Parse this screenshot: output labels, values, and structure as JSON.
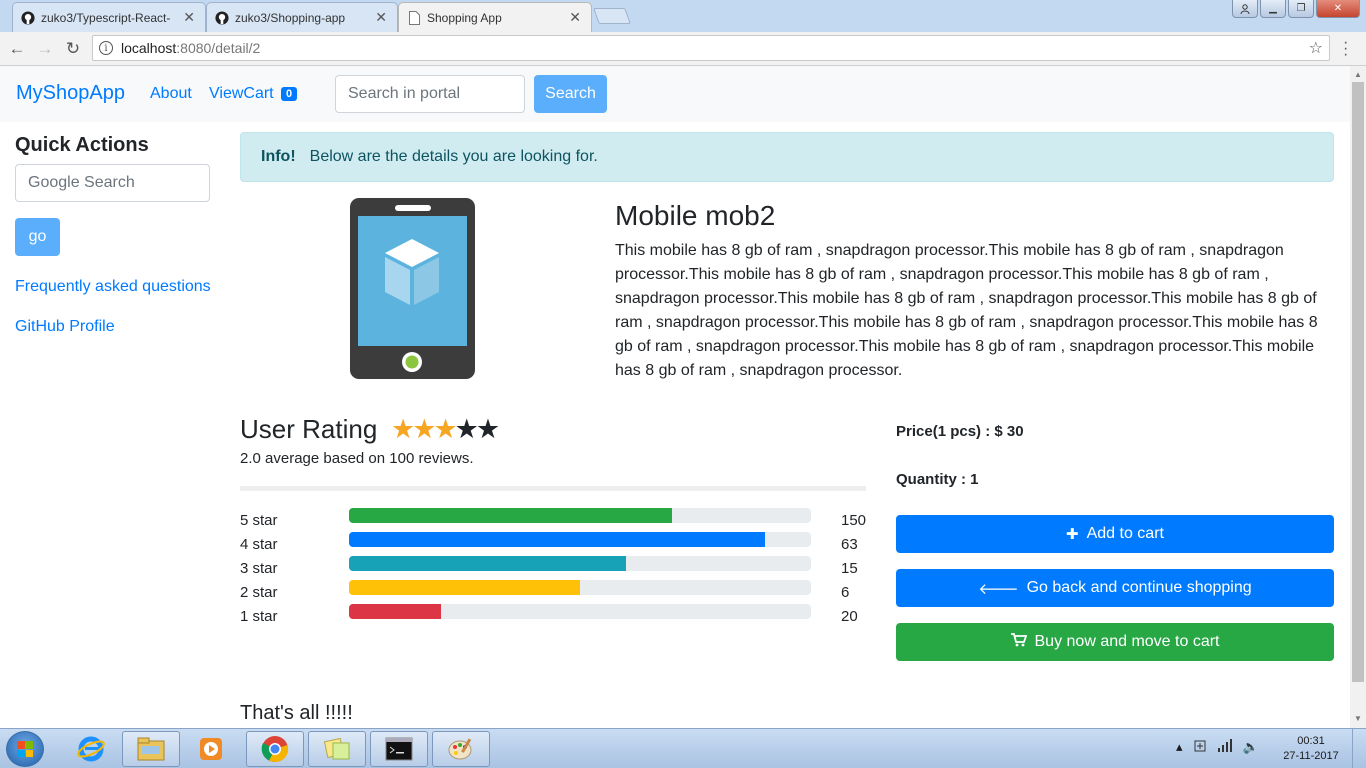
{
  "browser": {
    "tabs": [
      {
        "title": "zuko3/Typescript-React-",
        "icon": "github-icon"
      },
      {
        "title": "zuko3/Shopping-app",
        "icon": "github-icon"
      },
      {
        "title": "Shopping App",
        "icon": "page-icon"
      }
    ],
    "url_host": "localhost",
    "url_path": ":8080/detail/2"
  },
  "navbar": {
    "brand": "MyShopApp",
    "about": "About",
    "view_cart": "ViewCart",
    "cart_count": "0",
    "search_placeholder": "Search in portal",
    "search_button": "Search"
  },
  "sidebar": {
    "title": "Quick Actions",
    "google_placeholder": "Google Search",
    "go_button": "go",
    "links": [
      "Frequently asked questions",
      "GitHub Profile"
    ]
  },
  "alert": {
    "strong": "Info!",
    "text": "Below are the details you are looking for."
  },
  "product": {
    "title": "Mobile mob2",
    "description": "This mobile has 8 gb of ram , snapdragon processor.This mobile has 8 gb of ram , snapdragon processor.This mobile has 8 gb of ram , snapdragon processor.This mobile has 8 gb of ram , snapdragon processor.This mobile has 8 gb of ram , snapdragon processor.This mobile has 8 gb of ram , snapdragon processor.This mobile has 8 gb of ram , snapdragon processor.This mobile has 8 gb of ram , snapdragon processor.This mobile has 8 gb of ram , snapdragon processor.This mobile has 8 gb of ram , snapdragon processor."
  },
  "rating": {
    "heading": "User Rating",
    "stars_filled": 3,
    "stars_total": 5,
    "summary": "2.0 average based on 100 reviews.",
    "rows": [
      {
        "label": "5 star",
        "count": "150",
        "fill": 0.7,
        "color": "#28a745"
      },
      {
        "label": "4 star",
        "count": "63",
        "fill": 0.9,
        "color": "#007bff"
      },
      {
        "label": "3 star",
        "count": "15",
        "fill": 0.6,
        "color": "#17a2b8"
      },
      {
        "label": "2 star",
        "count": "6",
        "fill": 0.5,
        "color": "#ffc107"
      },
      {
        "label": "1 star",
        "count": "20",
        "fill": 0.2,
        "color": "#dc3545"
      }
    ]
  },
  "purchase": {
    "price": "Price(1 pcs) :  $ 30",
    "quantity": "Quantity :  1",
    "add_to_cart": "Add to cart",
    "go_back": "Go back and continue shopping",
    "buy_now": "Buy now and move to cart"
  },
  "footer": {
    "text": "That's all !!!!!"
  },
  "taskbar": {
    "time": "00:31",
    "date": "27-11-2017"
  }
}
